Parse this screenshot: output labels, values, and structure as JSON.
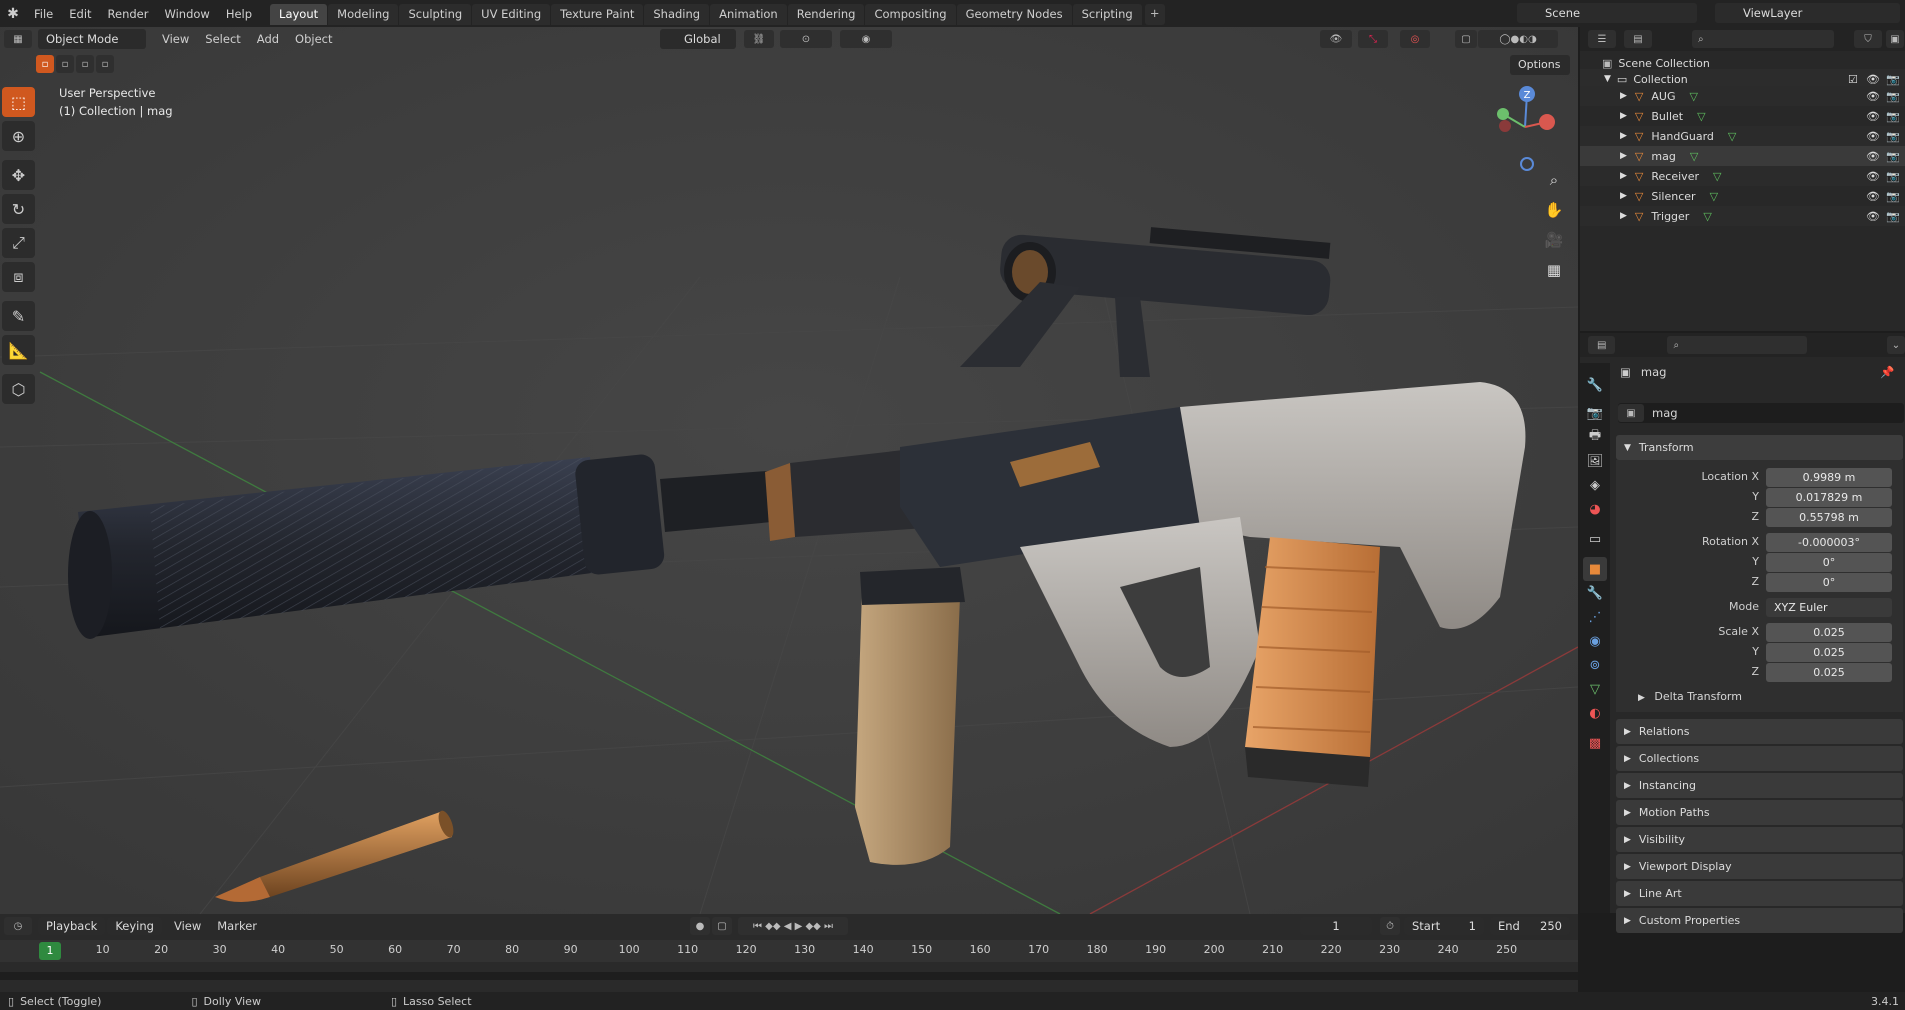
{
  "menu": [
    "File",
    "Edit",
    "Render",
    "Window",
    "Help"
  ],
  "workspaces": [
    "Layout",
    "Modeling",
    "Sculpting",
    "UV Editing",
    "Texture Paint",
    "Shading",
    "Animation",
    "Rendering",
    "Compositing",
    "Geometry Nodes",
    "Scripting"
  ],
  "active_workspace": "Layout",
  "scene": "Scene",
  "view_layer": "ViewLayer",
  "viewport": {
    "mode": "Object Mode",
    "menus": [
      "View",
      "Select",
      "Add",
      "Object"
    ],
    "orientation": "Global",
    "options_label": "Options",
    "overlay_line1": "User Perspective",
    "overlay_line2": "(1) Collection | mag",
    "gizmo": {
      "z": "Z",
      "y": "Y",
      "x": "X"
    }
  },
  "outliner": {
    "root": "Scene Collection",
    "collection": "Collection",
    "objects": [
      "AUG",
      "Bullet",
      "HandGuard",
      "mag",
      "Receiver",
      "Silencer",
      "Trigger"
    ],
    "selected": "mag"
  },
  "properties": {
    "object_name": "mag",
    "name_field": "mag",
    "transform_label": "Transform",
    "location": {
      "label": "Location X",
      "x": "0.9989 m",
      "y": "0.017829 m",
      "z": "0.55798 m"
    },
    "rotation": {
      "label": "Rotation X",
      "x": "-0.000003°",
      "y": "0°",
      "z": "0°"
    },
    "mode_label": "Mode",
    "mode_value": "XYZ Euler",
    "scale": {
      "label": "Scale X",
      "x": "0.025",
      "y": "0.025",
      "z": "0.025"
    },
    "axis_y": "Y",
    "axis_z": "Z",
    "delta": "Delta Transform",
    "panels": [
      "Relations",
      "Collections",
      "Instancing",
      "Motion Paths",
      "Visibility",
      "Viewport Display",
      "Line Art",
      "Custom Properties"
    ]
  },
  "timeline": {
    "menus": [
      "Playback",
      "Keying",
      "View",
      "Marker"
    ],
    "current_frame": "1",
    "start_label": "Start",
    "start": "1",
    "end_label": "End",
    "end": "250",
    "ticks": [
      "10",
      "20",
      "30",
      "40",
      "50",
      "60",
      "70",
      "80",
      "90",
      "100",
      "110",
      "120",
      "130",
      "140",
      "150",
      "160",
      "170",
      "180",
      "190",
      "200",
      "210",
      "220",
      "230",
      "240",
      "250"
    ],
    "playhead": "1"
  },
  "status": {
    "left": "Select (Toggle)",
    "mid": "Dolly View",
    "right": "Lasso Select",
    "version": "3.4.1"
  },
  "colors": {
    "accent": "#d0581f",
    "selected_row": "#334d80",
    "bg_viewport": "#3d3d3d"
  }
}
